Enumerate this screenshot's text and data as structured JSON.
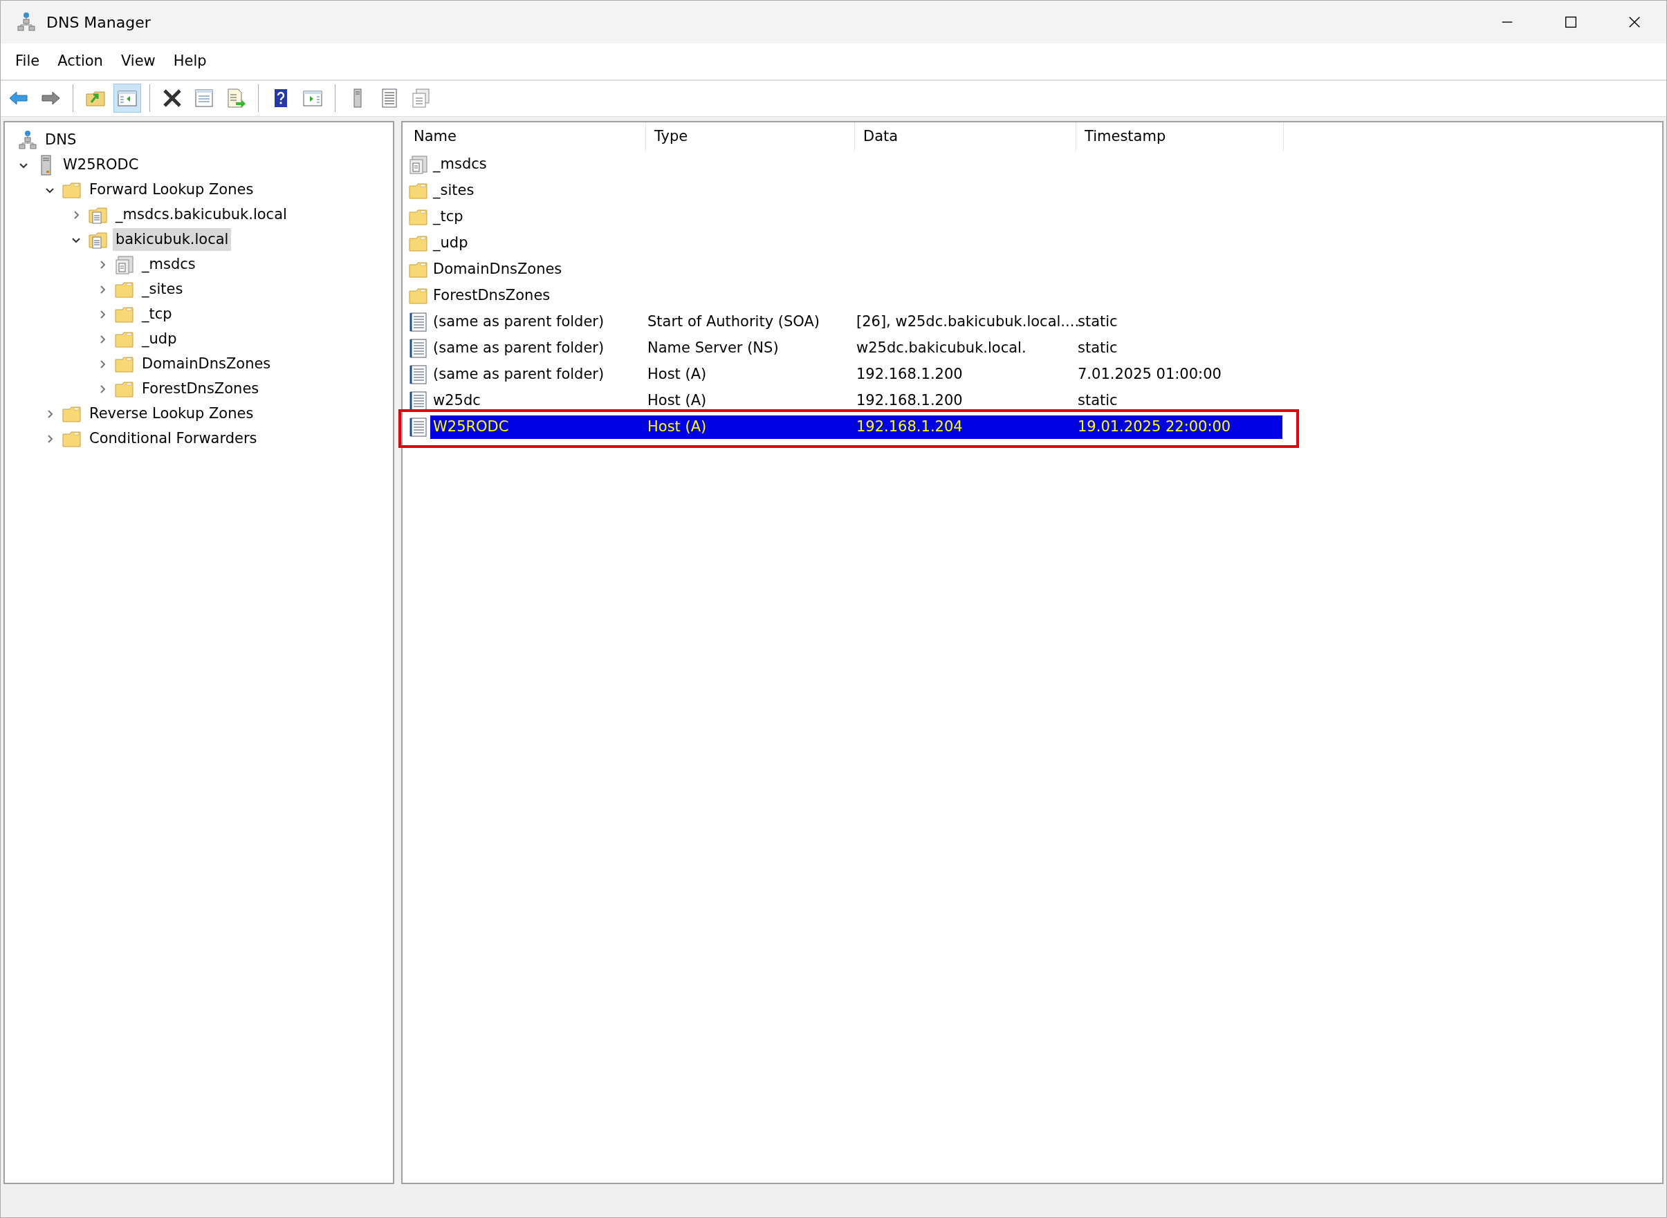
{
  "window": {
    "title": "DNS Manager"
  },
  "menu": [
    "File",
    "Action",
    "View",
    "Help"
  ],
  "toolbar": [
    {
      "kind": "back",
      "pressed": false
    },
    {
      "kind": "forward",
      "pressed": false
    },
    {
      "kind": "separator"
    },
    {
      "kind": "up-folder",
      "pressed": false
    },
    {
      "kind": "console-tree",
      "pressed": true
    },
    {
      "kind": "separator"
    },
    {
      "kind": "delete",
      "pressed": false
    },
    {
      "kind": "properties",
      "pressed": false
    },
    {
      "kind": "export",
      "pressed": false
    },
    {
      "kind": "separator"
    },
    {
      "kind": "help",
      "pressed": false
    },
    {
      "kind": "action-pane",
      "pressed": false
    },
    {
      "kind": "separator"
    },
    {
      "kind": "server",
      "pressed": false
    },
    {
      "kind": "records",
      "pressed": false
    },
    {
      "kind": "copy",
      "pressed": false
    }
  ],
  "tree": [
    {
      "label": "DNS",
      "kind": "dns",
      "selected": false,
      "children": [
        {
          "label": "W25RODC",
          "kind": "server",
          "expanded": true,
          "selected": false,
          "children": [
            {
              "label": "Forward Lookup Zones",
              "kind": "folder",
              "expanded": true,
              "selected": false,
              "children": [
                {
                  "label": "_msdcs.bakicubuk.local",
                  "kind": "zone",
                  "expanded": false,
                  "selected": false
                },
                {
                  "label": "bakicubuk.local",
                  "kind": "zone",
                  "expanded": true,
                  "selected": true,
                  "children": [
                    {
                      "label": "_msdcs",
                      "kind": "delegation",
                      "expanded": false,
                      "selected": false
                    },
                    {
                      "label": "_sites",
                      "kind": "folder",
                      "expanded": false,
                      "selected": false
                    },
                    {
                      "label": "_tcp",
                      "kind": "folder",
                      "expanded": false,
                      "selected": false
                    },
                    {
                      "label": "_udp",
                      "kind": "folder",
                      "expanded": false,
                      "selected": false
                    },
                    {
                      "label": "DomainDnsZones",
                      "kind": "folder",
                      "expanded": false,
                      "selected": false
                    },
                    {
                      "label": "ForestDnsZones",
                      "kind": "folder",
                      "expanded": false,
                      "selected": false
                    }
                  ]
                }
              ]
            },
            {
              "label": "Reverse Lookup Zones",
              "kind": "folder",
              "expanded": false,
              "selected": false
            },
            {
              "label": "Conditional Forwarders",
              "kind": "folder",
              "expanded": false,
              "selected": false
            }
          ]
        }
      ]
    }
  ],
  "table": {
    "columns": [
      "Name",
      "Type",
      "Data",
      "Timestamp"
    ],
    "rows": [
      {
        "kind": "delegation",
        "name": "_msdcs",
        "selected": false
      },
      {
        "kind": "folder",
        "name": "_sites",
        "selected": false
      },
      {
        "kind": "folder",
        "name": "_tcp",
        "selected": false
      },
      {
        "kind": "folder",
        "name": "_udp",
        "selected": false
      },
      {
        "kind": "folder",
        "name": "DomainDnsZones",
        "selected": false
      },
      {
        "kind": "folder",
        "name": "ForestDnsZones",
        "selected": false
      },
      {
        "kind": "record",
        "name": "(same as parent folder)",
        "type": "Start of Authority (SOA)",
        "data": "[26], w25dc.bakicubuk.local....",
        "timestamp": "static",
        "selected": false
      },
      {
        "kind": "record",
        "name": "(same as parent folder)",
        "type": "Name Server (NS)",
        "data": "w25dc.bakicubuk.local.",
        "timestamp": "static",
        "selected": false
      },
      {
        "kind": "record",
        "name": "(same as parent folder)",
        "type": "Host (A)",
        "data": "192.168.1.200",
        "timestamp": "7.01.2025 01:00:00",
        "selected": false
      },
      {
        "kind": "record",
        "name": "w25dc",
        "type": "Host (A)",
        "data": "192.168.1.200",
        "timestamp": "static",
        "selected": false
      },
      {
        "kind": "record",
        "name": "W25RODC",
        "type": "Host (A)",
        "data": "192.168.1.204",
        "timestamp": "19.01.2025 22:00:00",
        "selected": true,
        "outlined": true
      }
    ]
  }
}
